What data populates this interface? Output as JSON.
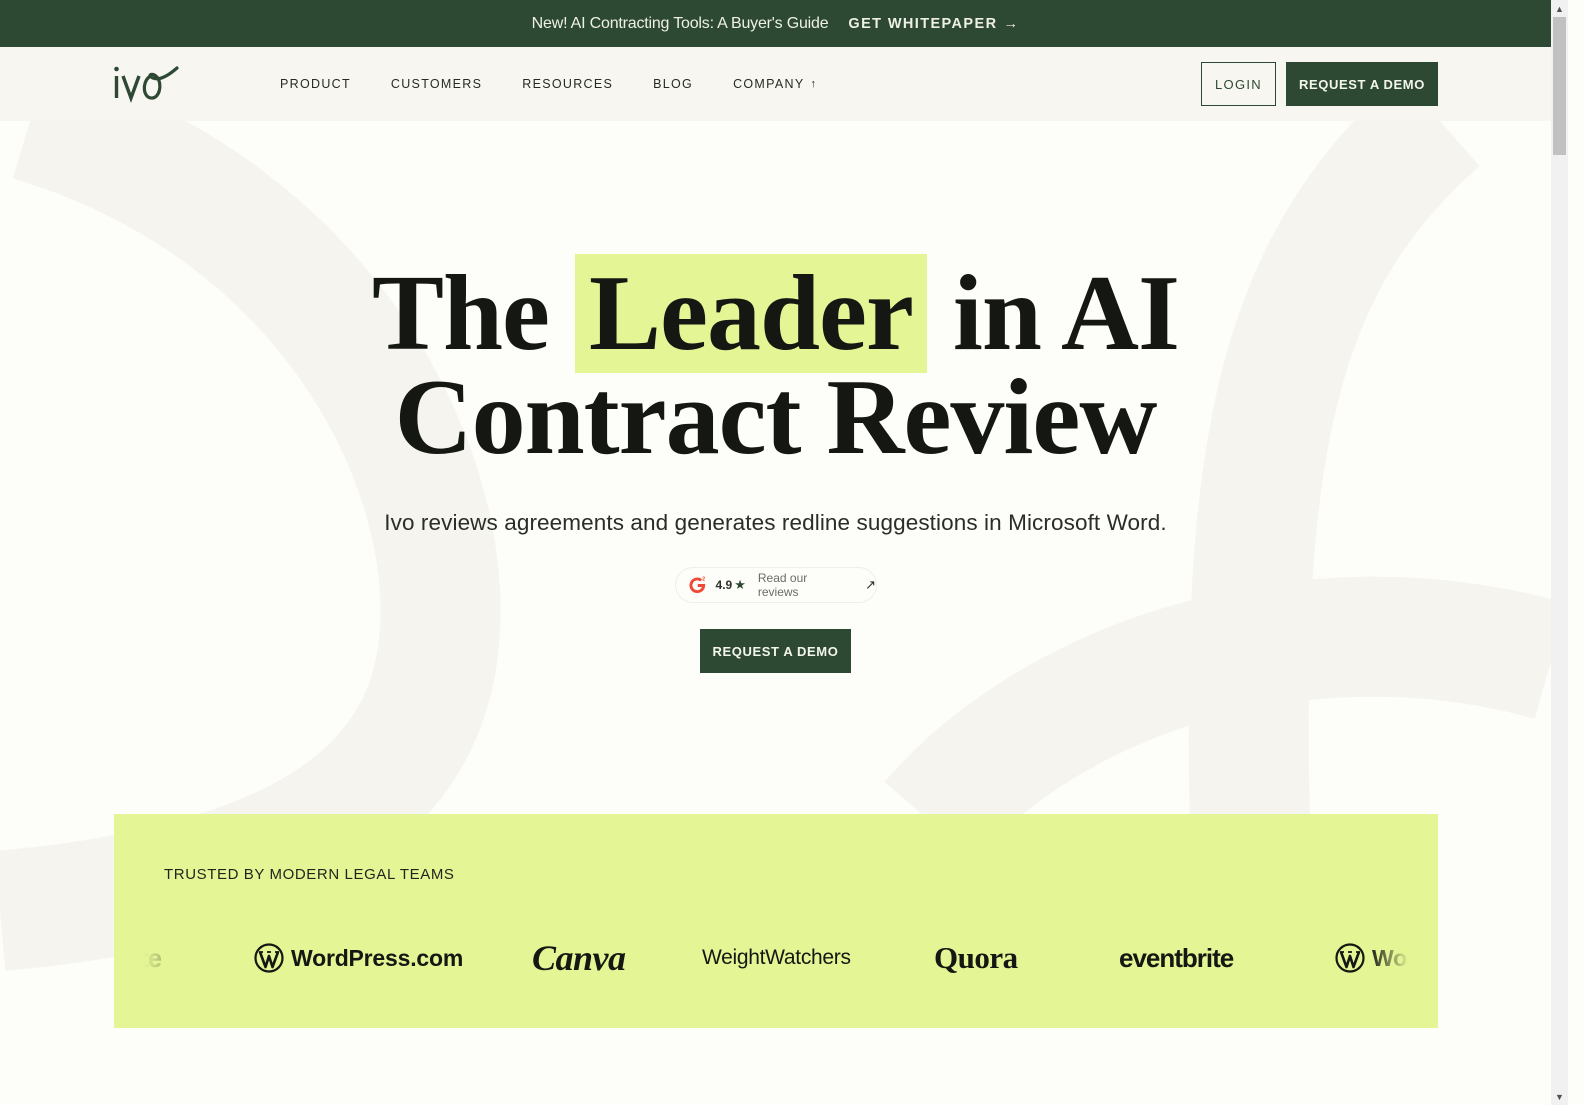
{
  "announcement": {
    "text": "New! AI Contracting Tools: A Buyer's Guide",
    "link_label": "GET WHITEPAPER",
    "link_arrow": "→"
  },
  "header": {
    "logo_alt": "ivo",
    "nav": [
      {
        "label": "PRODUCT"
      },
      {
        "label": "CUSTOMERS"
      },
      {
        "label": "RESOURCES"
      },
      {
        "label": "BLOG"
      },
      {
        "label": "COMPANY",
        "icon": "↑"
      }
    ],
    "login_label": "LOGIN",
    "demo_label": "REQUEST A DEMO"
  },
  "hero": {
    "title_before": "The",
    "title_highlight": "Leader",
    "title_after": "in AI",
    "title_line2": "Contract Review",
    "subtitle": "Ivo reviews agreements and generates redline suggestions in Microsoft Word.",
    "reviews": {
      "rating": "4.9",
      "star": "★",
      "text": "Read our reviews",
      "arrow": "↗"
    },
    "cta_label": "REQUEST A DEMO"
  },
  "trusted": {
    "label": "TRUSTED BY MODERN LEGAL TEAMS",
    "logos": [
      {
        "name": "eventbrite-partial",
        "text": "te"
      },
      {
        "name": "WordPress.com",
        "text": "WordPress.com"
      },
      {
        "name": "Canva",
        "text": "Canva"
      },
      {
        "name": "WeightWatchers",
        "text": "WeightWatchers"
      },
      {
        "name": "Quora",
        "text": "Quora"
      },
      {
        "name": "eventbrite",
        "text": "eventbrite"
      },
      {
        "name": "WordPress-partial",
        "text": "WordPress.com"
      }
    ]
  },
  "colors": {
    "brand_green": "#2d4934",
    "accent_lime": "#e4f595",
    "background": "#fdfdf9",
    "header_bg": "#f8f6f1",
    "g2_red": "#ef4a35"
  }
}
